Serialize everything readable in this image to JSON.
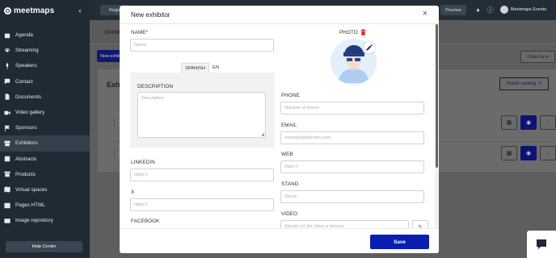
{
  "app": {
    "brand": "meetmaps"
  },
  "sidebar": {
    "items": [
      {
        "label": "Agenda",
        "icon": "calendar-icon"
      },
      {
        "label": "Streaming",
        "icon": "broadcast-icon"
      },
      {
        "label": "Speakers",
        "icon": "microphone-icon"
      },
      {
        "label": "Contact",
        "icon": "chat-icon"
      },
      {
        "label": "Documents",
        "icon": "document-icon"
      },
      {
        "label": "Video gallery",
        "icon": "video-icon"
      },
      {
        "label": "Sponsors",
        "icon": "flag-icon"
      },
      {
        "label": "Exhibitors",
        "icon": "store-icon",
        "active": true
      },
      {
        "label": "Abstracts",
        "icon": "abstract-icon"
      },
      {
        "label": "Products",
        "icon": "box-icon"
      },
      {
        "label": "Virtual spaces",
        "icon": "map-icon"
      },
      {
        "label": "Pages HTML",
        "icon": "code-icon"
      },
      {
        "label": "Image repository",
        "icon": "image-icon"
      }
    ],
    "help": "Help Center"
  },
  "topbar": {
    "regis_label": "Regis",
    "preview_label": "Preview",
    "user_name": "Meetmaps Events"
  },
  "page": {
    "tab_label": "EXHIBITORS",
    "new_button": "New exhibitor",
    "order_button": "Order by",
    "panel_title": "Exhibitors",
    "public_catalog": "Public catalog"
  },
  "modal": {
    "title": "New exhibitor",
    "name_label": "NAME*",
    "name_placeholder": "Name",
    "lang_tabs": [
      "SPANISH",
      "EN"
    ],
    "description_label": "DESCRIPTION",
    "description_placeholder": "Description",
    "linkedin_label": "LINKEDIN",
    "linkedin_placeholder": "https://",
    "x_label": "X",
    "x_placeholder": "https://",
    "facebook_label": "FACEBOOK",
    "photo_label": "PHOTO",
    "phone_label": "PHONE",
    "phone_placeholder": "Number of phone",
    "email_label": "EMAIL",
    "email_placeholder": "example@domain.com",
    "web_label": "WEB",
    "web_placeholder": "https://",
    "stand_label": "STAND",
    "stand_placeholder": "Stand...",
    "video_label": "VIDEO",
    "video_placeholder": "Ajouter url del video a mostrar",
    "save_label": "Save"
  },
  "colors": {
    "primary": "#0b1eb2",
    "sidebar": "#1f2a35",
    "danger": "#e03030"
  }
}
